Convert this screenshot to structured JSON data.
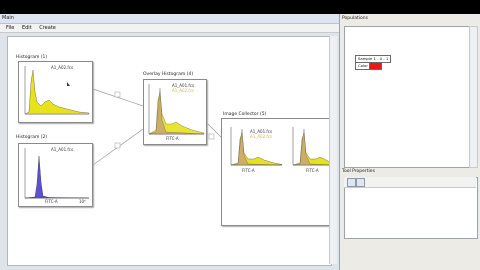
{
  "window": {
    "title": "Main"
  },
  "menu": [
    {
      "label": "File"
    },
    {
      "label": "Edit"
    },
    {
      "label": "Create"
    }
  ],
  "nodes": {
    "histogram1": {
      "title": "Histogram (1)",
      "sample": "A1_A02.fcs",
      "axis": "FITC-A"
    },
    "histogram2": {
      "title": "Histogram (2)",
      "sample": "A1_A01.fcs",
      "axis": "FITC-A",
      "axis_max": "10⁵"
    },
    "overlay": {
      "title": "Overlay Histogram (4)",
      "sample1": "A1_A01.fcs",
      "sample2": "A1_A02.fcs",
      "axis": "FITC-A"
    },
    "collector": {
      "title": "Image Collector (5)",
      "sample1": "A1_A01.fcs",
      "sample2": "A1_A02.fcs",
      "axis": "FITC-A"
    }
  },
  "populations": {
    "title": "Populations",
    "items": [
      {
        "label": "Sample 1 - 0 - 1"
      },
      {
        "label": "Color"
      }
    ],
    "color": "#e81818"
  },
  "tool_properties": {
    "title": "Tool Properties"
  },
  "colors": {
    "yellow": "#e6e21c",
    "blue": "#5b4fd6",
    "red": "#e81818",
    "tan": "#c8a07a"
  }
}
